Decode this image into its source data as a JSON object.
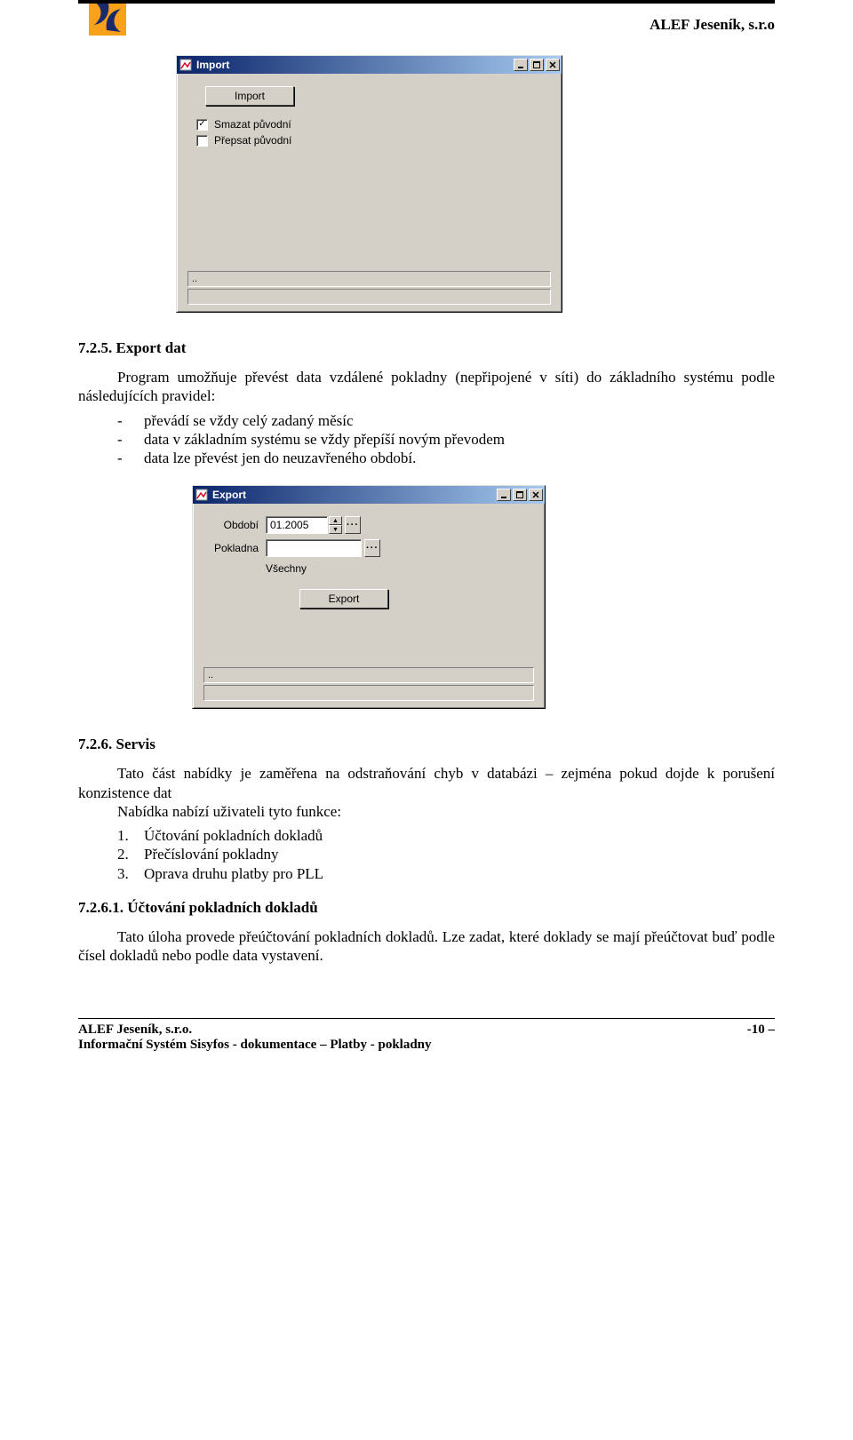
{
  "header": {
    "company": "ALEF Jeseník, s.r.o"
  },
  "win_import": {
    "title": "Import",
    "button": "Import",
    "chk1_label": "Smazat původní",
    "chk1_checked": "✓",
    "chk2_label": "Přepsat původní",
    "chk2_checked": "",
    "status": ".."
  },
  "sec725": {
    "heading": "7.2.5. Export dat",
    "para": "Program umožňuje převést data vzdálené pokladny (nepřipojené v síti) do základního systému podle následujících pravidel:",
    "b1": "převádí se vždy celý zadaný měsíc",
    "b2": "data v základním systému se vždy přepíší novým převodem",
    "b3": "data lze převést jen do neuzavřeného období."
  },
  "win_export": {
    "title": "Export",
    "lbl_obdobi": "Období",
    "val_obdobi": "01.2005",
    "lbl_pokladna": "Pokladna",
    "val_pokladna": "",
    "chk_vsechny": "Všechny",
    "button": "Export",
    "status": ".."
  },
  "sec726": {
    "heading": "7.2.6. Servis",
    "para1": "Tato část nabídky je zaměřena na odstraňování chyb v databázi – zejména pokud dojde k porušení konzistence dat",
    "para2": "Nabídka nabízí uživateli tyto funkce:",
    "i1": "Účtování pokladních dokladů",
    "i2": "Přečíslování pokladny",
    "i3": "Oprava druhu platby pro PLL"
  },
  "sec7261": {
    "heading": "7.2.6.1. Účtování pokladních dokladů",
    "para": "Tato úloha provede přeúčtování pokladních dokladů. Lze zadat, které doklady se mají přeúčtovat buď podle čísel dokladů nebo podle data vystavení."
  },
  "footer": {
    "left1": "ALEF Jeseník, s.r.o.",
    "left2": "Informační Systém Sisyfos - dokumentace – Platby - pokladny",
    "right": "-10 –"
  }
}
